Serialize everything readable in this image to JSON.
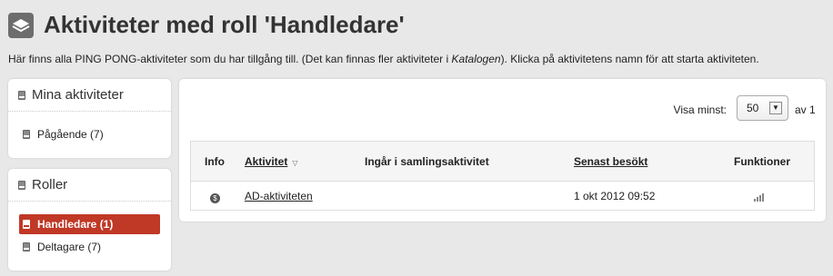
{
  "header": {
    "title": "Aktiviteter med roll 'Handledare'",
    "intro_before": "Här finns alla PING PONG-aktiviteter som du har tillgång till. (Det kan finnas fler aktiviteter i ",
    "intro_link": "Katalogen",
    "intro_after": "). Klicka på aktivitetens namn för att starta aktiviteten."
  },
  "sidebar": {
    "my_activities": {
      "title": "Mina aktiviteter",
      "items": [
        {
          "label": "Pågående (7)"
        }
      ]
    },
    "roles": {
      "title": "Roller",
      "items": [
        {
          "label": "Handledare (1)",
          "active": true
        },
        {
          "label": "Deltagare (7)",
          "active": false
        }
      ]
    }
  },
  "main": {
    "visa_label": "Visa minst:",
    "visa_value": "50",
    "av_label": "av 1",
    "table": {
      "columns": [
        "Info",
        "Aktivitet",
        "Ingår i samlingsaktivitet",
        "Senast besökt",
        "Funktioner"
      ],
      "rows": [
        {
          "info_icon": "info-icon",
          "activity": "AD-aktiviteten",
          "collection": "",
          "last_visited": "1 okt 2012 09:52",
          "functions_icon": "bar-chart-icon"
        }
      ]
    }
  },
  "colors": {
    "active": "#c03826",
    "background": "#e8e8e8"
  }
}
